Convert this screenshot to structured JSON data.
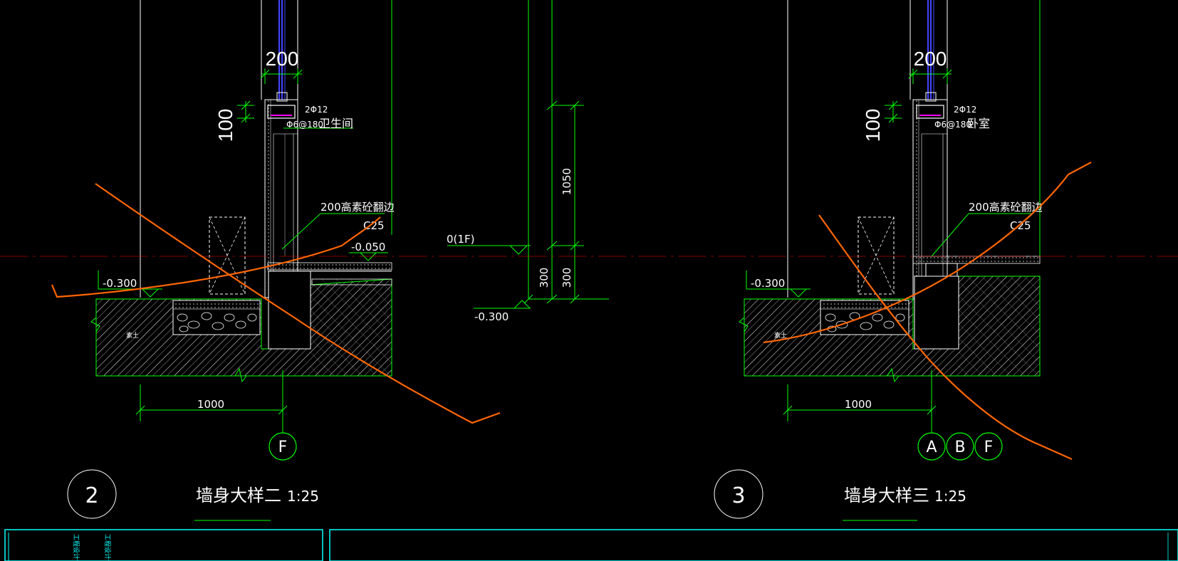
{
  "colors": {
    "background": "#000000",
    "wall": "#ffffff",
    "dimension": "#00ff00",
    "markup": "#ff6600",
    "rebar": "#ff00ff",
    "glass": "#4444ff",
    "axis_line": "#ff0000",
    "title_block": "#00ffff"
  },
  "detail2": {
    "dim_width": "200",
    "dim_height": "100",
    "rebar_main": "2Φ12",
    "rebar_stirrup": "Φ6@180",
    "room": "卫生间",
    "curb_note": "200高素砼翻边",
    "concrete_grade": "C25",
    "elev_floor": "-0.050",
    "elev_outdoor": "-0.300",
    "soil": "素土",
    "dim_base": "1000",
    "axis": "F",
    "number": "2",
    "title": "墙身大样二",
    "scale": "1:25"
  },
  "middle": {
    "elev_1f": "0(1F)",
    "elev_outdoor": "-0.300",
    "dim_window": "1050",
    "dim_sill": "300",
    "dim_plinth": "300"
  },
  "detail3": {
    "dim_width": "200",
    "dim_height": "100",
    "rebar_main": "2Φ12",
    "rebar_stirrup": "Φ6@180",
    "room": "卧室",
    "curb_note": "200高素砼翻边",
    "concrete_grade": "C25",
    "elev_outdoor": "-0.300",
    "soil": "素土",
    "dim_base": "1000",
    "axes": [
      "A",
      "B",
      "F"
    ],
    "number": "3",
    "title": "墙身大样三",
    "scale": "1:25"
  },
  "title_block": {
    "left_col1": "工程设计专用",
    "left_col2": "工程设计专用"
  }
}
